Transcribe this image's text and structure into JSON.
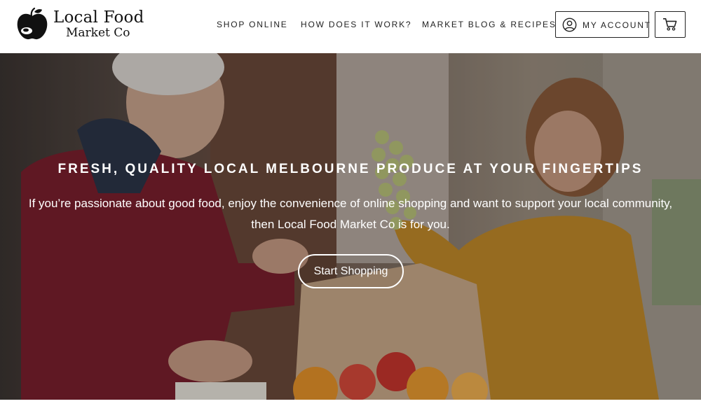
{
  "brand": {
    "name_line1": "Local Food",
    "name_line2": "Market Co"
  },
  "nav": {
    "items": [
      {
        "label": "SHOP ONLINE"
      },
      {
        "label": "HOW DOES IT WORK?"
      },
      {
        "label": "MARKET BLOG & RECIPES"
      }
    ],
    "account_label": "MY ACCOUNT"
  },
  "icons": {
    "logo": "apple-logo-icon",
    "account": "user-circle-icon",
    "cart": "shopping-cart-icon"
  },
  "hero": {
    "title": "FRESH, QUALITY LOCAL MELBOURNE PRODUCE AT YOUR FINGERTIPS",
    "text_line1": "If you’re passionate about good food, enjoy the convenience of online shopping and want to support your local community,",
    "text_line2": "then Local Food Market Co is for you.",
    "cta_label": "Start Shopping"
  },
  "colors": {
    "text": "#222222",
    "header_bg": "#ffffff",
    "hero_text": "#ffffff"
  }
}
